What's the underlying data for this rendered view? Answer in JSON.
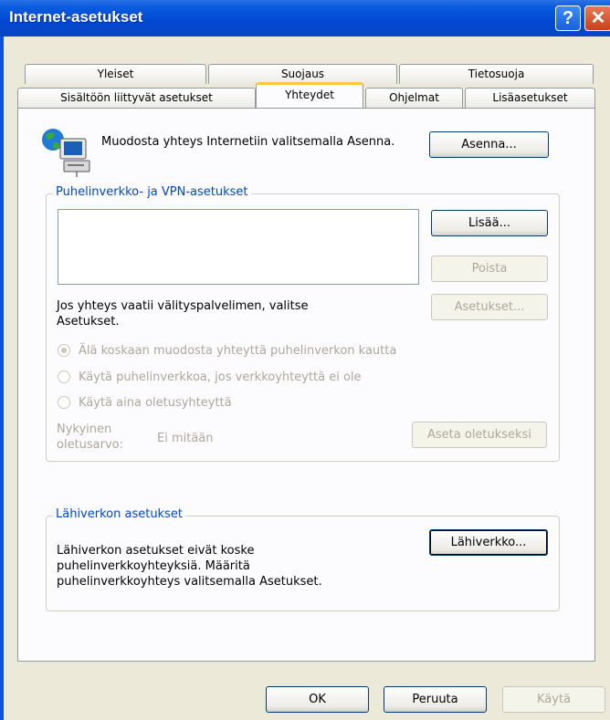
{
  "window": {
    "title": "Internet-asetukset",
    "help_label": "?",
    "close_label": "✕"
  },
  "tabs_row1": [
    "Yleiset",
    "Suojaus",
    "Tietosuoja"
  ],
  "tabs_row2": [
    "Sisältöön liittyvät asetukset",
    "Yhteydet",
    "Ohjelmat",
    "Lisäasetukset"
  ],
  "active_tab": "Yhteydet",
  "setup": {
    "text": "Muodosta yhteys Internetiin valitsemalla Asenna.",
    "button": "Asenna..."
  },
  "dialup": {
    "group_label": "Puhelinverkko- ja VPN-asetukset",
    "list_items": [],
    "add_button": "Lisää...",
    "remove_button": "Poista",
    "settings_button": "Asetukset...",
    "proxy_text": "Jos yhteys vaatii välityspalvelimen, valitse Asetukset.",
    "radio_options": [
      {
        "label": "Älä koskaan muodosta yhteyttä puhelinverkon kautta",
        "checked": true
      },
      {
        "label": "Käytä puhelinverkkoa, jos verkkoyhteyttä ei ole",
        "checked": false
      },
      {
        "label": "Käytä aina oletusyhteyttä",
        "checked": false
      }
    ],
    "default_label": "Nykyinen oletusarvo:",
    "default_value": "Ei mitään",
    "set_default_button": "Aseta oletukseksi"
  },
  "lan": {
    "group_label": "Lähiverkon asetukset",
    "text": "Lähiverkon asetukset eivät koske puhelinverkkoyhteyksiä. Määritä puhelinverkkoyhteys valitsemalla Asetukset.",
    "button": "Lähiverkko..."
  },
  "footer": {
    "ok": "OK",
    "cancel": "Peruuta",
    "apply": "Käytä"
  },
  "colors": {
    "titlebar": "#0a5ce0",
    "group_label": "#0046d5",
    "dialog_bg": "#ece9d8",
    "disabled_text": "#aca899",
    "active_tab_highlight": "#ffc73c"
  }
}
